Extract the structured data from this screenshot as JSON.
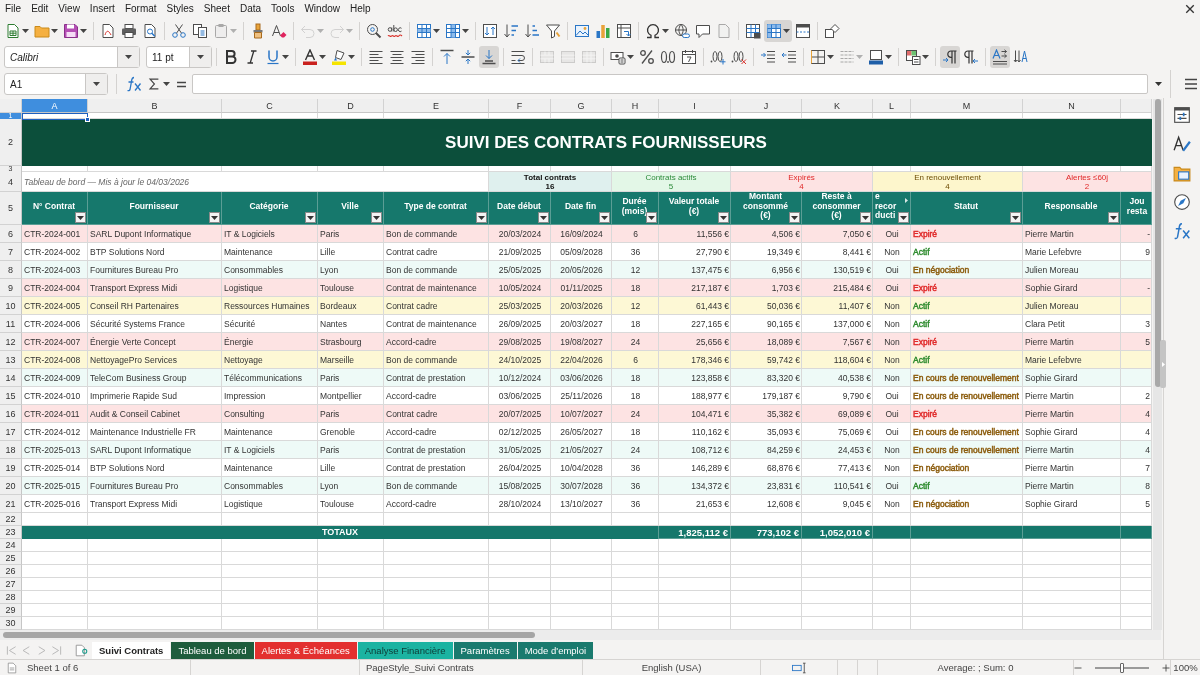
{
  "menu": [
    "File",
    "Edit",
    "View",
    "Insert",
    "Format",
    "Styles",
    "Sheet",
    "Data",
    "Tools",
    "Window",
    "Help"
  ],
  "standard_toolbar": [
    [
      {
        "kind": "new",
        "dropdown": true,
        "pressed": false,
        "disabled": false
      },
      {
        "kind": "open",
        "dropdown": true,
        "pressed": false,
        "disabled": false
      },
      {
        "kind": "save",
        "dropdown": true,
        "pressed": false,
        "disabled": false
      }
    ],
    [
      {
        "kind": "pdf",
        "dropdown": false,
        "pressed": false,
        "disabled": false
      },
      {
        "kind": "print",
        "dropdown": false,
        "pressed": false,
        "disabled": false
      },
      {
        "kind": "preview",
        "dropdown": false,
        "pressed": false,
        "disabled": false
      }
    ],
    [
      {
        "kind": "cut",
        "dropdown": false,
        "pressed": false,
        "disabled": false
      },
      {
        "kind": "copy",
        "dropdown": false,
        "pressed": false,
        "disabled": false
      },
      {
        "kind": "paste",
        "dropdown": true,
        "pressed": false,
        "disabled": true
      }
    ],
    [
      {
        "kind": "clone",
        "dropdown": false,
        "pressed": false,
        "disabled": false
      },
      {
        "kind": "clear",
        "dropdown": false,
        "pressed": false,
        "disabled": false
      }
    ],
    [
      {
        "kind": "undo",
        "dropdown": true,
        "pressed": false,
        "disabled": true
      },
      {
        "kind": "redo",
        "dropdown": true,
        "pressed": false,
        "disabled": true
      }
    ],
    [
      {
        "kind": "find",
        "dropdown": false,
        "pressed": false,
        "disabled": false
      },
      {
        "kind": "spelling",
        "dropdown": false,
        "pressed": false,
        "disabled": false
      }
    ],
    [
      {
        "kind": "rows",
        "dropdown": true,
        "pressed": false,
        "disabled": false
      },
      {
        "kind": "columns",
        "dropdown": true,
        "pressed": false,
        "disabled": false
      }
    ],
    [
      {
        "kind": "sort",
        "dropdown": false,
        "pressed": false,
        "disabled": false
      },
      {
        "kind": "ascending",
        "dropdown": false,
        "pressed": false,
        "disabled": false
      },
      {
        "kind": "descending",
        "dropdown": false,
        "pressed": false,
        "disabled": false
      },
      {
        "kind": "autofilter",
        "dropdown": false,
        "pressed": false,
        "disabled": false
      }
    ],
    [
      {
        "kind": "image",
        "dropdown": false,
        "pressed": false,
        "disabled": false
      },
      {
        "kind": "chart",
        "dropdown": false,
        "pressed": false,
        "disabled": false
      },
      {
        "kind": "pivot",
        "dropdown": false,
        "pressed": false,
        "disabled": false
      }
    ],
    [
      {
        "kind": "special",
        "dropdown": true,
        "pressed": false,
        "disabled": false
      },
      {
        "kind": "hyperlink",
        "dropdown": false,
        "pressed": false,
        "disabled": false
      },
      {
        "kind": "comment",
        "dropdown": false,
        "pressed": false,
        "disabled": false
      },
      {
        "kind": "headerfooter",
        "dropdown": false,
        "pressed": false,
        "disabled": true
      }
    ],
    [
      {
        "kind": "printarea",
        "dropdown": false,
        "pressed": false,
        "disabled": false
      },
      {
        "kind": "freeze",
        "dropdown": true,
        "pressed": true,
        "disabled": false
      },
      {
        "kind": "split",
        "dropdown": false,
        "pressed": false,
        "disabled": false
      }
    ],
    [
      {
        "kind": "draw",
        "dropdown": false,
        "pressed": false,
        "disabled": false
      }
    ]
  ],
  "format_toolbar": {
    "font_name": {
      "value": "Calibri"
    },
    "font_size": {
      "value": "11 pt"
    },
    "groups": [
      [
        {
          "kind": "bold",
          "dropdown": false,
          "pressed": false,
          "disabled": false
        },
        {
          "kind": "italic",
          "dropdown": false,
          "pressed": false,
          "disabled": false
        },
        {
          "kind": "underline",
          "dropdown": true,
          "pressed": false,
          "disabled": false
        }
      ],
      [
        {
          "kind": "fontcolor",
          "dropdown": true,
          "pressed": false,
          "disabled": false
        },
        {
          "kind": "highlight",
          "dropdown": true,
          "pressed": false,
          "disabled": false
        }
      ],
      [
        {
          "kind": "alignleft",
          "dropdown": false,
          "pressed": false,
          "disabled": false
        },
        {
          "kind": "aligncenter",
          "dropdown": false,
          "pressed": false,
          "disabled": false
        },
        {
          "kind": "alignright",
          "dropdown": false,
          "pressed": false,
          "disabled": false
        }
      ],
      [
        {
          "kind": "aligntop",
          "dropdown": false,
          "pressed": false,
          "disabled": false
        },
        {
          "kind": "alignmiddle",
          "dropdown": false,
          "pressed": false,
          "disabled": false
        },
        {
          "kind": "alignbottom",
          "dropdown": false,
          "pressed": true,
          "disabled": false
        }
      ],
      [
        {
          "kind": "wrap",
          "dropdown": false,
          "pressed": false,
          "disabled": false
        }
      ],
      [
        {
          "kind": "mergecenter",
          "dropdown": false,
          "pressed": false,
          "disabled": true
        },
        {
          "kind": "merge",
          "dropdown": false,
          "pressed": false,
          "disabled": true
        },
        {
          "kind": "unmerge",
          "dropdown": false,
          "pressed": false,
          "disabled": true
        }
      ],
      [
        {
          "kind": "currency",
          "dropdown": true,
          "pressed": false,
          "disabled": false
        },
        {
          "kind": "percent",
          "dropdown": false,
          "pressed": false,
          "disabled": false
        },
        {
          "kind": "standard",
          "dropdown": false,
          "pressed": false,
          "disabled": false
        },
        {
          "kind": "date",
          "dropdown": false,
          "pressed": false,
          "disabled": false
        }
      ],
      [
        {
          "kind": "adddecimal",
          "dropdown": false,
          "pressed": false,
          "disabled": false
        },
        {
          "kind": "deletedecimal",
          "dropdown": false,
          "pressed": false,
          "disabled": false
        }
      ],
      [
        {
          "kind": "indent",
          "dropdown": false,
          "pressed": false,
          "disabled": false
        },
        {
          "kind": "outdent",
          "dropdown": false,
          "pressed": false,
          "disabled": false
        }
      ],
      [
        {
          "kind": "borders",
          "dropdown": true,
          "pressed": false,
          "disabled": false
        },
        {
          "kind": "borderstyle",
          "dropdown": true,
          "pressed": false,
          "disabled": true
        },
        {
          "kind": "bordercolor",
          "dropdown": true,
          "pressed": false,
          "disabled": false
        }
      ],
      [
        {
          "kind": "conditional",
          "dropdown": true,
          "pressed": false,
          "disabled": false
        }
      ],
      [
        {
          "kind": "ltr",
          "dropdown": false,
          "pressed": true,
          "disabled": false
        },
        {
          "kind": "rtl",
          "dropdown": false,
          "pressed": false,
          "disabled": false
        }
      ],
      [
        {
          "kind": "textdirection",
          "dropdown": false,
          "pressed": true,
          "disabled": false
        },
        {
          "kind": "stacked",
          "dropdown": false,
          "pressed": false,
          "disabled": false
        }
      ]
    ]
  },
  "formula_bar": {
    "cell_reference": "A1"
  },
  "sheet": {
    "column_headers": [
      {
        "label": "A",
        "selected": true
      },
      {
        "label": "B",
        "selected": false
      },
      {
        "label": "C",
        "selected": false
      },
      {
        "label": "D",
        "selected": false
      },
      {
        "label": "E",
        "selected": false
      },
      {
        "label": "F",
        "selected": false
      },
      {
        "label": "G",
        "selected": false
      },
      {
        "label": "H",
        "selected": false
      },
      {
        "label": "I",
        "selected": false
      },
      {
        "label": "J",
        "selected": false
      },
      {
        "label": "K",
        "selected": false
      },
      {
        "label": "L",
        "selected": false
      },
      {
        "label": "M",
        "selected": false
      },
      {
        "label": "N",
        "selected": false
      }
    ],
    "row_headers": [
      {
        "label": "1",
        "selected": true
      },
      {
        "label": "2",
        "selected": false
      },
      {
        "label": "3",
        "selected": false
      },
      {
        "label": "4",
        "selected": false
      },
      {
        "label": "5",
        "selected": false
      },
      {
        "label": "6",
        "selected": false
      },
      {
        "label": "7",
        "selected": false
      },
      {
        "label": "8",
        "selected": false
      },
      {
        "label": "9",
        "selected": false
      },
      {
        "label": "10",
        "selected": false
      },
      {
        "label": "11",
        "selected": false
      },
      {
        "label": "12",
        "selected": false
      },
      {
        "label": "13",
        "selected": false
      },
      {
        "label": "14",
        "selected": false
      },
      {
        "label": "15",
        "selected": false
      },
      {
        "label": "16",
        "selected": false
      },
      {
        "label": "17",
        "selected": false
      },
      {
        "label": "18",
        "selected": false
      },
      {
        "label": "19",
        "selected": false
      },
      {
        "label": "20",
        "selected": false
      },
      {
        "label": "21",
        "selected": false
      },
      {
        "label": "22",
        "selected": false
      },
      {
        "label": "23",
        "selected": false
      },
      {
        "label": "24",
        "selected": false
      },
      {
        "label": "25",
        "selected": false
      },
      {
        "label": "26",
        "selected": false
      },
      {
        "label": "27",
        "selected": false
      },
      {
        "label": "28",
        "selected": false
      },
      {
        "label": "29",
        "selected": false
      },
      {
        "label": "30",
        "selected": false
      }
    ],
    "title": "SUIVI DES CONTRATS FOURNISSEURS",
    "subtitle": "Tableau de bord — Mis à jour le 04/03/2026",
    "kpis": [
      {
        "kind": "total",
        "label": "Total contrats",
        "value": "16"
      },
      {
        "kind": "active",
        "label": "Contrats actifs",
        "value": "5"
      },
      {
        "kind": "expired",
        "label": "Expirés",
        "value": "4"
      },
      {
        "kind": "renewal",
        "label": "En renouvellement",
        "value": "4"
      },
      {
        "kind": "expired",
        "label": "Alertes ≤60j",
        "value": "2"
      }
    ],
    "columns": [
      {
        "label": "N° Contrat",
        "filter": true,
        "clipped": false
      },
      {
        "label": "Fournisseur",
        "filter": true,
        "clipped": false
      },
      {
        "label": "Catégorie",
        "filter": true,
        "clipped": false
      },
      {
        "label": "Ville",
        "filter": true,
        "clipped": false
      },
      {
        "label": "Type de contrat",
        "filter": true,
        "clipped": false
      },
      {
        "label": "Date début",
        "filter": true,
        "clipped": false
      },
      {
        "label": "Date fin",
        "filter": true,
        "clipped": false
      },
      {
        "label": "Durée\n(mois)",
        "filter": true,
        "clipped": false
      },
      {
        "label": "Valeur totale\n(€)",
        "filter": true,
        "clipped": false
      },
      {
        "label": "Montant\nconsommé\n(€)",
        "filter": true,
        "clipped": false
      },
      {
        "label": "Reste à\nconsommer\n(€)",
        "filter": true,
        "clipped": false
      },
      {
        "label": "e\nrecor\nducti",
        "filter": true,
        "clipped": true
      },
      {
        "label": "Statut",
        "filter": true,
        "clipped": false
      },
      {
        "label": "Responsable",
        "filter": true,
        "clipped": false
      },
      {
        "label": "Jou\nresta",
        "filter": false,
        "clipped": false
      }
    ],
    "rows": [
      {
        "color": "#fde3e3",
        "cells": [
          "CTR-2024-001",
          "SARL Dupont Informatique",
          "IT & Logiciels",
          "Paris",
          "Bon de commande",
          "20/03/2024",
          "16/09/2024",
          "6",
          "11,556 €",
          "4,506 €",
          "7,050 €",
          "Oui"
        ],
        "status": {
          "text": "Expiré",
          "color": "#e02a2a"
        },
        "responsible": "Pierre Martin",
        "column_15": "-"
      },
      {
        "color": "#ffffff",
        "cells": [
          "CTR-2024-002",
          "BTP Solutions Nord",
          "Maintenance",
          "Lille",
          "Contrat cadre",
          "21/09/2025",
          "05/09/2028",
          "36",
          "27,790 €",
          "19,349 €",
          "8,441 €",
          "Non"
        ],
        "status": {
          "text": "Actif",
          "color": "#2e8b2e"
        },
        "responsible": "Marie Lefebvre",
        "column_15": "9"
      },
      {
        "color": "#eefaf7",
        "cells": [
          "CTR-2024-003",
          "Fournitures Bureau Pro",
          "Consommables",
          "Lyon",
          "Bon de commande",
          "25/05/2025",
          "20/05/2026",
          "12",
          "137,475 €",
          "6,956 €",
          "130,519 €",
          "Oui"
        ],
        "status": {
          "text": "En négociation",
          "color": "#8a5a0a"
        },
        "responsible": "Julien Moreau"
      },
      {
        "color": "#fde3e3",
        "cells": [
          "CTR-2024-004",
          "Transport Express Midi",
          "Logistique",
          "Toulouse",
          "Contrat de maintenance",
          "10/05/2024",
          "01/11/2025",
          "18",
          "217,187 €",
          "1,703 €",
          "215,484 €",
          "Oui"
        ],
        "status": {
          "text": "Expiré",
          "color": "#e02a2a"
        },
        "responsible": "Sophie Girard",
        "column_15": "-"
      },
      {
        "color": "#fdf8d5",
        "cells": [
          "CTR-2024-005",
          "Conseil RH Partenaires",
          "Ressources Humaines",
          "Bordeaux",
          "Contrat cadre",
          "25/03/2025",
          "20/03/2026",
          "12",
          "61,443 €",
          "50,036 €",
          "11,407 €",
          "Non"
        ],
        "status": {
          "text": "Actif",
          "color": "#2e8b2e"
        },
        "responsible": "Julien Moreau"
      },
      {
        "color": "#ffffff",
        "cells": [
          "CTR-2024-006",
          "Sécurité Systems France",
          "Sécurité",
          "Nantes",
          "Contrat de maintenance",
          "26/09/2025",
          "20/03/2027",
          "18",
          "227,165 €",
          "90,165 €",
          "137,000 €",
          "Non"
        ],
        "status": {
          "text": "Actif",
          "color": "#2e8b2e"
        },
        "responsible": "Clara Petit",
        "column_15": "3"
      },
      {
        "color": "#fde3e3",
        "cells": [
          "CTR-2024-007",
          "Énergie Verte Concept",
          "Énergie",
          "Strasbourg",
          "Accord-cadre",
          "29/08/2025",
          "19/08/2027",
          "24",
          "25,656 €",
          "18,089 €",
          "7,567 €",
          "Non"
        ],
        "status": {
          "text": "Expiré",
          "color": "#e02a2a"
        },
        "responsible": "Pierre Martin",
        "column_15": "5"
      },
      {
        "color": "#fdf8d5",
        "cells": [
          "CTR-2024-008",
          "NettoyagePro Services",
          "Nettoyage",
          "Marseille",
          "Bon de commande",
          "24/10/2025",
          "22/04/2026",
          "6",
          "178,346 €",
          "59,742 €",
          "118,604 €",
          "Non"
        ],
        "status": {
          "text": "Actif",
          "color": "#2e8b2e"
        },
        "responsible": "Marie Lefebvre"
      },
      {
        "color": "#eefaf7",
        "cells": [
          "CTR-2024-009",
          "TeleCom Business Group",
          "Télécommunications",
          "Paris",
          "Contrat de prestation",
          "10/12/2024",
          "03/06/2026",
          "18",
          "123,858 €",
          "83,320 €",
          "40,538 €",
          "Non"
        ],
        "status": {
          "text": "En cours de renouvellement",
          "color": "#8a5a0a"
        },
        "responsible": "Sophie Girard"
      },
      {
        "color": "#ffffff",
        "cells": [
          "CTR-2024-010",
          "Imprimerie Rapide Sud",
          "Impression",
          "Montpellier",
          "Accord-cadre",
          "03/06/2025",
          "25/11/2026",
          "18",
          "188,977 €",
          "179,187 €",
          "9,790 €",
          "Oui"
        ],
        "status": {
          "text": "En cours de renouvellement",
          "color": "#8a5a0a"
        },
        "responsible": "Pierre Martin",
        "column_15": "2"
      },
      {
        "color": "#fde3e3",
        "cells": [
          "CTR-2024-011",
          "Audit & Conseil Cabinet",
          "Consulting",
          "Paris",
          "Contrat cadre",
          "20/07/2025",
          "10/07/2027",
          "24",
          "104,471 €",
          "35,382 €",
          "69,089 €",
          "Oui"
        ],
        "status": {
          "text": "Expiré",
          "color": "#e02a2a"
        },
        "responsible": "Pierre Martin",
        "column_15": "4"
      },
      {
        "color": "#ffffff",
        "cells": [
          "CTR-2024-012",
          "Maintenance Industrielle FR",
          "Maintenance",
          "Grenoble",
          "Accord-cadre",
          "02/12/2025",
          "26/05/2027",
          "18",
          "110,162 €",
          "35,093 €",
          "75,069 €",
          "Oui"
        ],
        "status": {
          "text": "En cours de renouvellement",
          "color": "#8a5a0a"
        },
        "responsible": "Sophie Girard",
        "column_15": "4"
      },
      {
        "color": "#eefaf7",
        "cells": [
          "CTR-2025-013",
          "SARL Dupont Informatique",
          "IT & Logiciels",
          "Paris",
          "Contrat de prestation",
          "31/05/2025",
          "21/05/2027",
          "24",
          "108,712 €",
          "84,259 €",
          "24,453 €",
          "Non"
        ],
        "status": {
          "text": "En cours de renouvellement",
          "color": "#8a5a0a"
        },
        "responsible": "Pierre Martin",
        "column_15": "4"
      },
      {
        "color": "#ffffff",
        "cells": [
          "CTR-2025-014",
          "BTP Solutions Nord",
          "Maintenance",
          "Lille",
          "Contrat de prestation",
          "26/04/2025",
          "10/04/2028",
          "36",
          "146,289 €",
          "68,876 €",
          "77,413 €",
          "Non"
        ],
        "status": {
          "text": "En négociation",
          "color": "#8a5a0a"
        },
        "responsible": "Pierre Martin",
        "column_15": "7"
      },
      {
        "color": "#eefaf7",
        "cells": [
          "CTR-2025-015",
          "Fournitures Bureau Pro",
          "Consommables",
          "Lyon",
          "Bon de commande",
          "15/08/2025",
          "30/07/2028",
          "36",
          "134,372 €",
          "23,831 €",
          "110,541 €",
          "Oui"
        ],
        "status": {
          "text": "Actif",
          "color": "#2e8b2e"
        },
        "responsible": "Pierre Martin",
        "column_15": "8"
      },
      {
        "color": "#ffffff",
        "cells": [
          "CTR-2025-016",
          "Transport Express Midi",
          "Logistique",
          "Toulouse",
          "Accord-cadre",
          "28/10/2024",
          "13/10/2027",
          "36",
          "21,653 €",
          "12,608 €",
          "9,045 €",
          "Non"
        ],
        "status": {
          "text": "En négociation",
          "color": "#8a5a0a"
        },
        "responsible": "Sophie Girard",
        "column_15": "5"
      }
    ],
    "totals": {
      "label": "TOTAUX",
      "values": [
        "1,825,112 €",
        "773,102 €",
        "1,052,010 €"
      ]
    }
  },
  "sheet_tabs": [
    {
      "label": "Suivi Contrats",
      "selected": true
    },
    {
      "label": "Tableau de bord",
      "selected": false,
      "color": "#1e5c3c"
    },
    {
      "label": "Alertes & Échéances",
      "selected": false,
      "color": "#e3302f"
    },
    {
      "label": "Analyse Financière",
      "selected": false,
      "color": "#1bb3a1"
    },
    {
      "label": "Paramètres",
      "selected": false,
      "color": "#1a7a6e"
    },
    {
      "label": "Mode d'emploi",
      "selected": false,
      "color": "#1a7a6e"
    }
  ],
  "status_bar": {
    "sheet_position": "Sheet 1 of 6",
    "page_style": "PageStyle_Suivi Contrats",
    "language": "English (USA)",
    "selection_summary": "Average: ; Sum: 0",
    "zoom": {
      "level": 0.5,
      "label": "100%"
    }
  }
}
